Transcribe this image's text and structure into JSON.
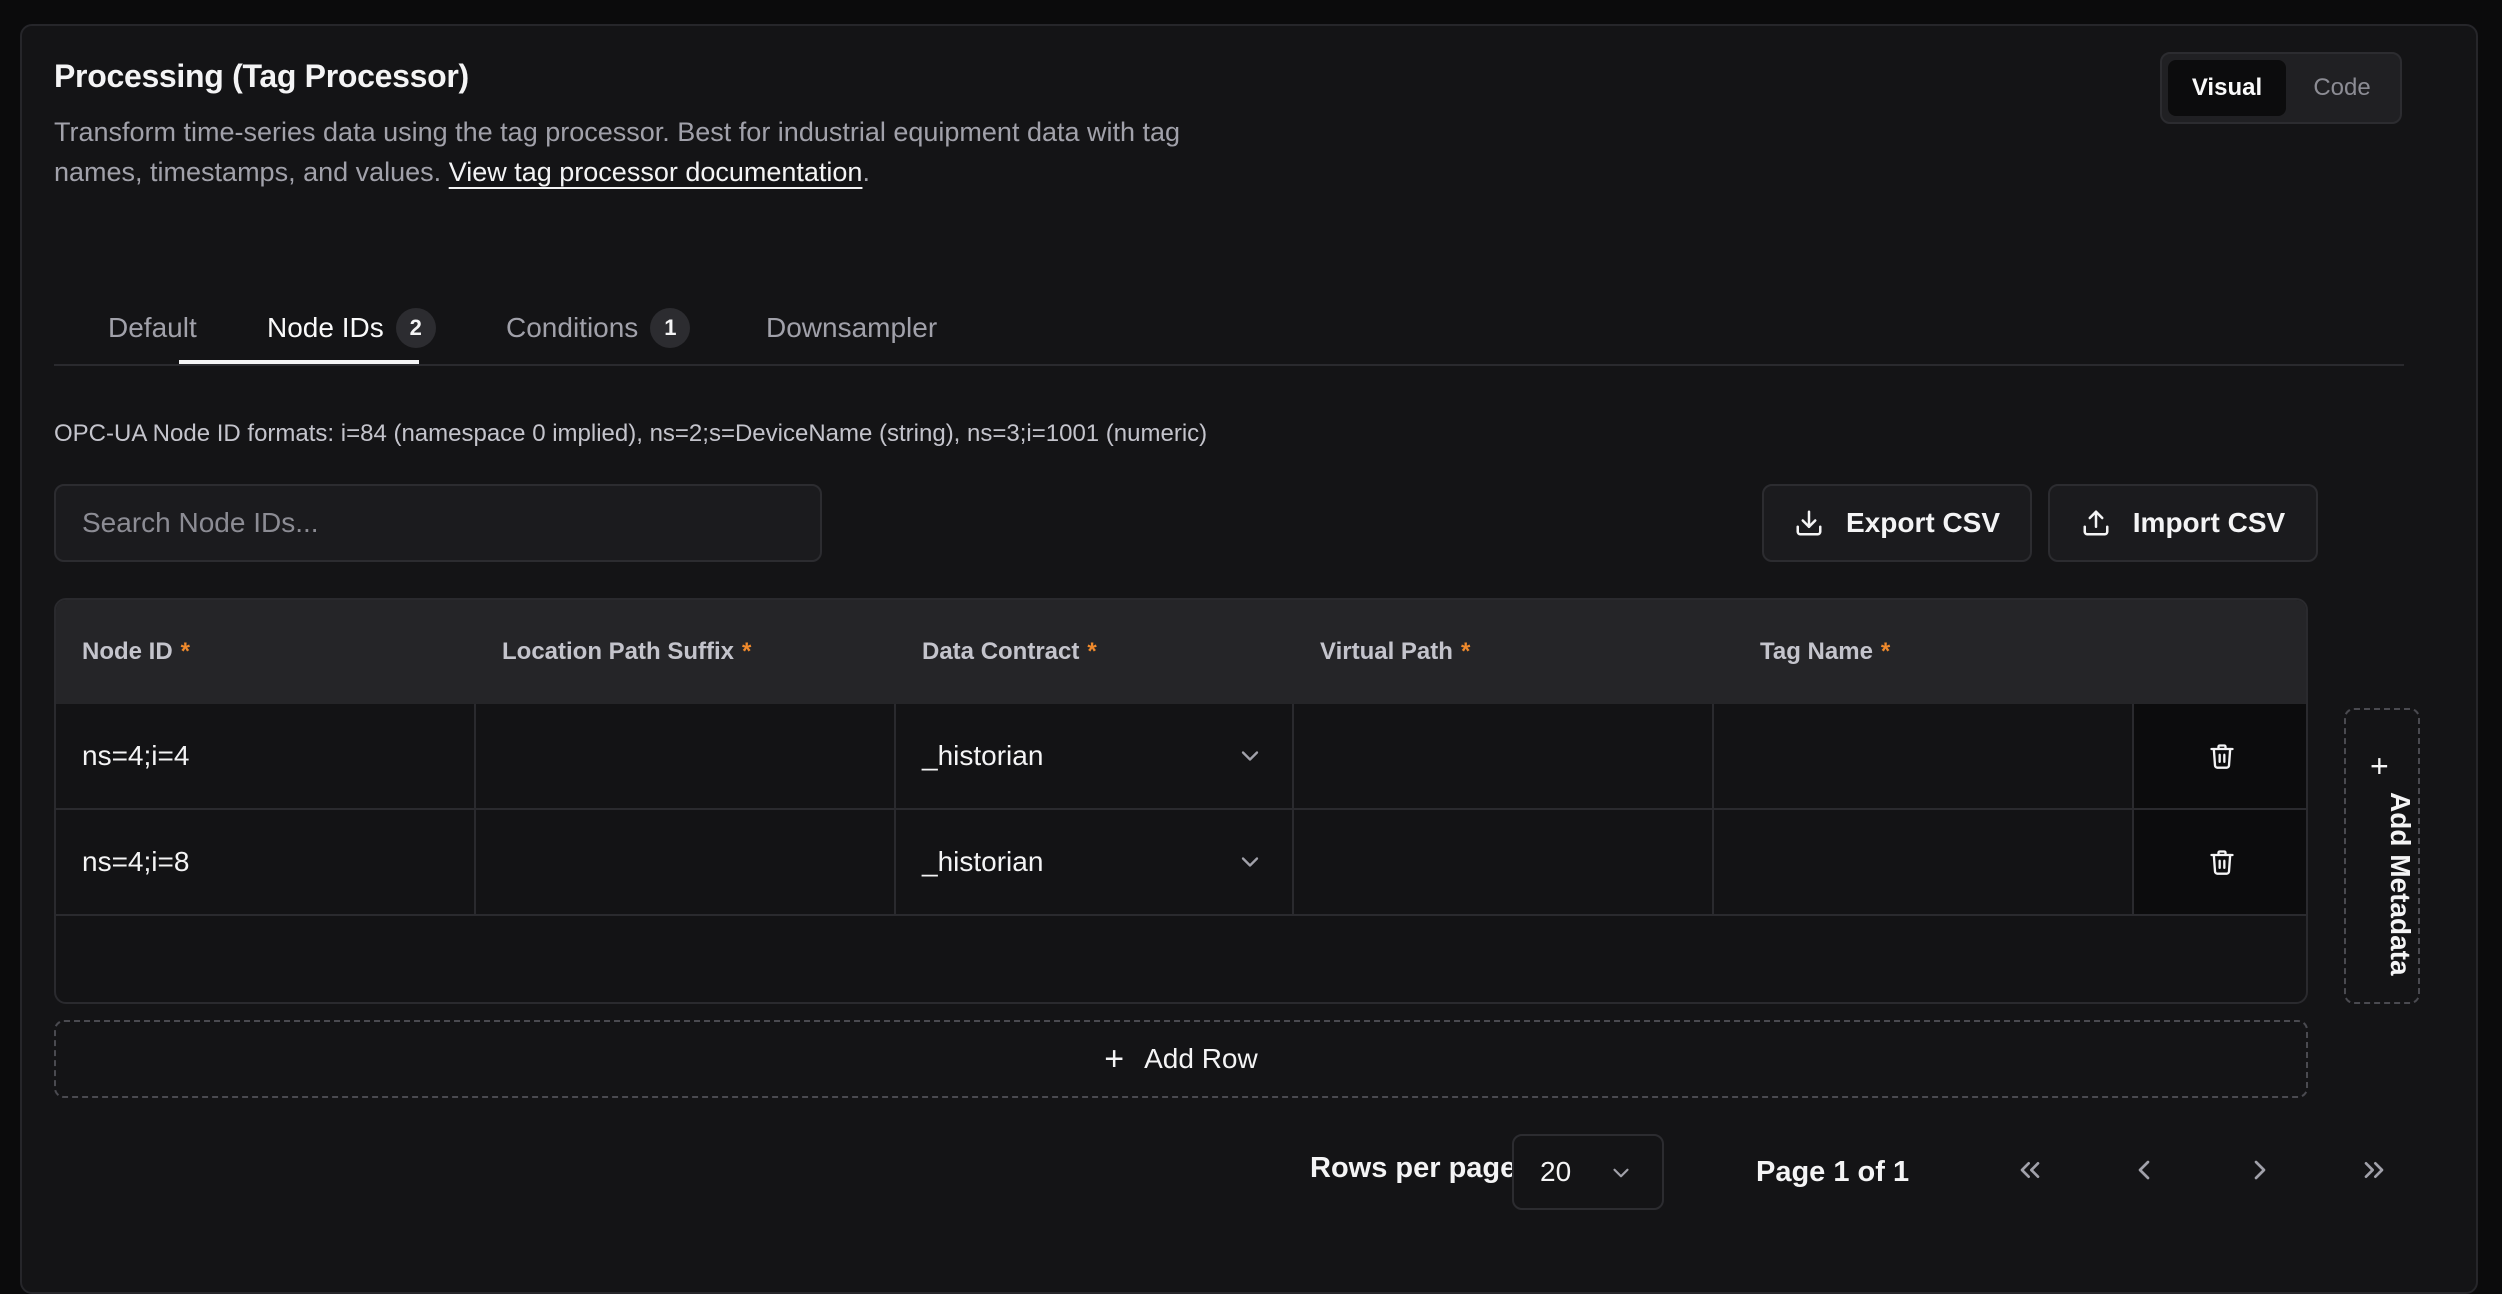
{
  "header": {
    "title": "Processing (Tag Processor)",
    "description": "Transform time-series data using the tag processor. Best for industrial equipment data with tag names, timestamps, and values.",
    "doc_link": "View tag processor documentation",
    "doc_suffix": "."
  },
  "view_toggle": {
    "visual": "Visual",
    "code": "Code",
    "selected": "Visual"
  },
  "tabs": [
    {
      "label": "Default",
      "badge": null
    },
    {
      "label": "Node IDs",
      "badge": "2",
      "active": true
    },
    {
      "label": "Conditions",
      "badge": "1"
    },
    {
      "label": "Downsampler",
      "badge": null
    }
  ],
  "hint": "OPC-UA Node ID formats: i=84 (namespace 0 implied), ns=2;s=DeviceName (string), ns=3;i=1001 (numeric)",
  "search": {
    "placeholder": "Search Node IDs...",
    "value": ""
  },
  "actions": {
    "export": "Export CSV",
    "import": "Import CSV"
  },
  "table": {
    "columns": [
      {
        "label": "Node ID",
        "required": "*"
      },
      {
        "label": "Location Path Suffix",
        "required": "*"
      },
      {
        "label": "Data Contract",
        "required": "*"
      },
      {
        "label": "Virtual Path",
        "required": "*"
      },
      {
        "label": "Tag Name",
        "required": "*"
      }
    ],
    "rows": [
      {
        "node_id": "ns=4;i=4",
        "location_path_suffix": "",
        "data_contract": "_historian",
        "virtual_path": "",
        "tag_name": ""
      },
      {
        "node_id": "ns=4;i=8",
        "location_path_suffix": "",
        "data_contract": "_historian",
        "virtual_path": "",
        "tag_name": ""
      }
    ]
  },
  "add_metadata": {
    "plus": "+",
    "label": "Add Metadata"
  },
  "add_row": {
    "plus": "+",
    "label": "Add Row"
  },
  "pagination": {
    "rows_per_page_label": "Rows per page",
    "rows_per_page": "20",
    "page_info": "Page 1 of 1"
  },
  "colors": {
    "background": "#141416",
    "accent_required": "#f08a2c",
    "border": "#2a2a2e"
  },
  "icons": [
    "download-icon",
    "upload-icon",
    "trash-icon",
    "chevron-down-icon",
    "plus-icon",
    "first-page-icon",
    "prev-page-icon",
    "next-page-icon",
    "last-page-icon"
  ]
}
